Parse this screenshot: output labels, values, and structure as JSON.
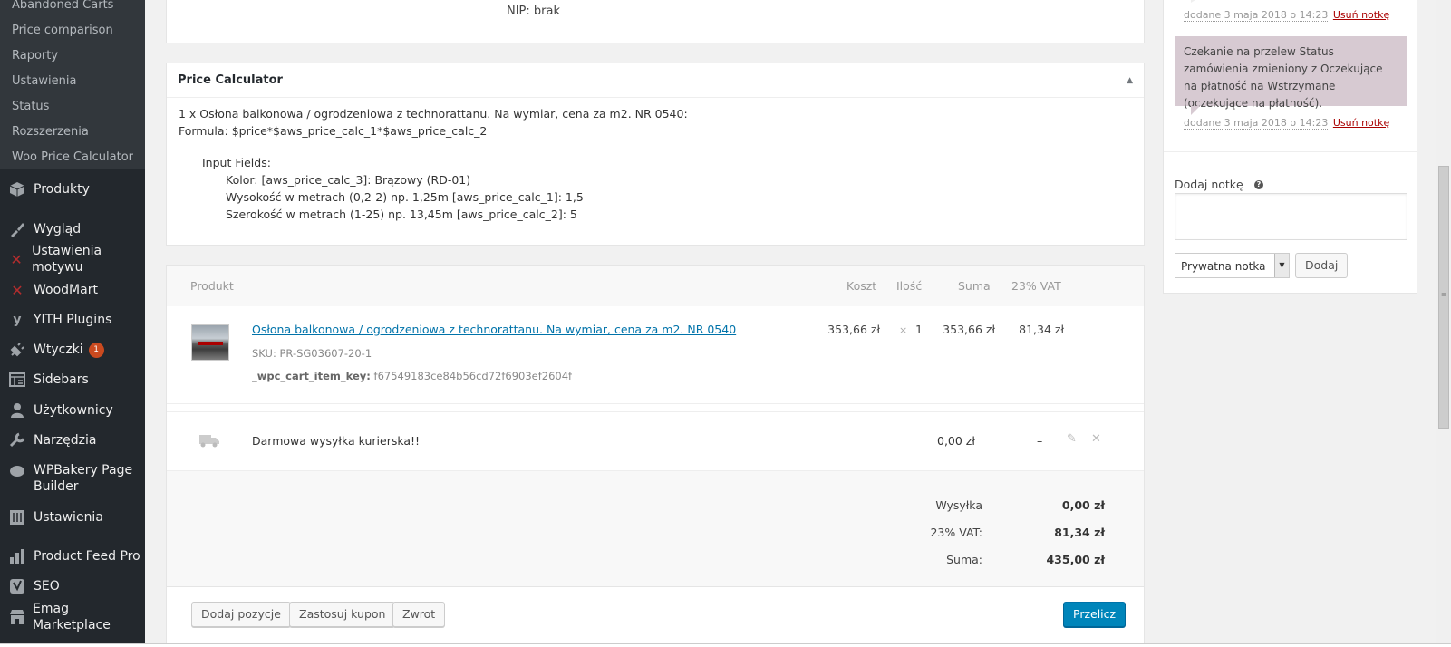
{
  "sidebar": {
    "submenu": [
      "Abandoned Carts",
      "Price comparison",
      "Raporty",
      "Ustawienia",
      "Status",
      "Rozszerzenia",
      "Woo Price Calculator"
    ],
    "menu": [
      {
        "label": "Produkty",
        "icon": "box-icon"
      },
      {
        "label": "Wygląd",
        "icon": "paintbrush-icon"
      },
      {
        "label": "Ustawienia motywu",
        "icon": "theme-settings-icon"
      },
      {
        "label": "WoodMart",
        "icon": "woodmart-icon"
      },
      {
        "label": "YITH Plugins",
        "icon": "yith-icon"
      },
      {
        "label": "Wtyczki",
        "icon": "plug-icon",
        "badge": "1"
      },
      {
        "label": "Sidebars",
        "icon": "sidebars-icon"
      },
      {
        "label": "Użytkownicy",
        "icon": "users-icon"
      },
      {
        "label": "Narzędzia",
        "icon": "wrench-icon"
      },
      {
        "label": "WPBakery Page Builder",
        "icon": "wpbakery-icon"
      },
      {
        "label": "Ustawienia",
        "icon": "settings-icon"
      },
      {
        "label": "Product Feed Pro",
        "icon": "bar-chart-icon"
      },
      {
        "label": "SEO",
        "icon": "yoast-icon"
      },
      {
        "label": "Emag Marketplace",
        "icon": "store-icon"
      }
    ]
  },
  "address": {
    "nip_label": "NIP:",
    "nip_value": "brak"
  },
  "calculator": {
    "title": "Price Calculator",
    "line1": "1 x Osłona balkonowa / ogrodzeniowa z technorattanu. Na wymiar, cena za m2. NR 0540:",
    "line2": "Formula: $price*$aws_price_calc_1*$aws_price_calc_2",
    "fields_title": "Input Fields:",
    "fields": [
      "Kolor: [aws_price_calc_3]: Brązowy (RD-01)",
      "Wysokość w metrach (0,2-2) np. 1,25m [aws_price_calc_1]: 1,5",
      "Szerokość w metrach (1-25) np. 13,45m [aws_price_calc_2]: 5"
    ]
  },
  "items": {
    "headers": {
      "product": "Produkt",
      "cost": "Koszt",
      "qty": "Ilość",
      "total": "Suma",
      "vat": "23% VAT"
    },
    "row": {
      "name": "Osłona balkonowa / ogrodzeniowa z technorattanu. Na wymiar, cena za m2. NR 0540",
      "sku_label": "SKU:",
      "sku": "PR-SG03607-20-1",
      "meta_key": "_wpc_cart_item_key:",
      "meta_value": "f67549183ce84b56cd72f6903ef2604f",
      "cost": "353,66 zł",
      "qty_x": "×",
      "qty": "1",
      "total": "353,66 zł",
      "vat": "81,34 zł"
    },
    "shipping": {
      "name": "Darmowa wysyłka kurierska!!",
      "cost": "0,00 zł",
      "vat": "–"
    }
  },
  "totals": [
    {
      "label": "Wysyłka",
      "value": "0,00 zł"
    },
    {
      "label": "23% VAT:",
      "value": "81,34 zł"
    },
    {
      "label": "Suma:",
      "value": "435,00 zł"
    }
  ],
  "actions": {
    "add_item": "Dodaj pozycje",
    "coupon": "Zastosuj kupon",
    "refund": "Zwrot",
    "recalc": "Przelicz"
  },
  "notes": {
    "meta1_date": "dodane 3 maja 2018 o 14:23",
    "delete": "Usuń notkę",
    "bubble": "Czekanie na przelew Status zamówienia zmieniony z Oczekujące na płatność na Wstrzymane (oczekujące na płatność).",
    "meta2_date": "dodane 3 maja 2018 o 14:23",
    "add_label": "Dodaj notkę",
    "type_value": "Prywatna notka",
    "add_button": "Dodaj"
  },
  "colors": {
    "accent": "#0085ba",
    "sidebar": "#23282d",
    "note_bg": "#d7cad2",
    "link": "#0073aa",
    "delete": "#a00"
  }
}
